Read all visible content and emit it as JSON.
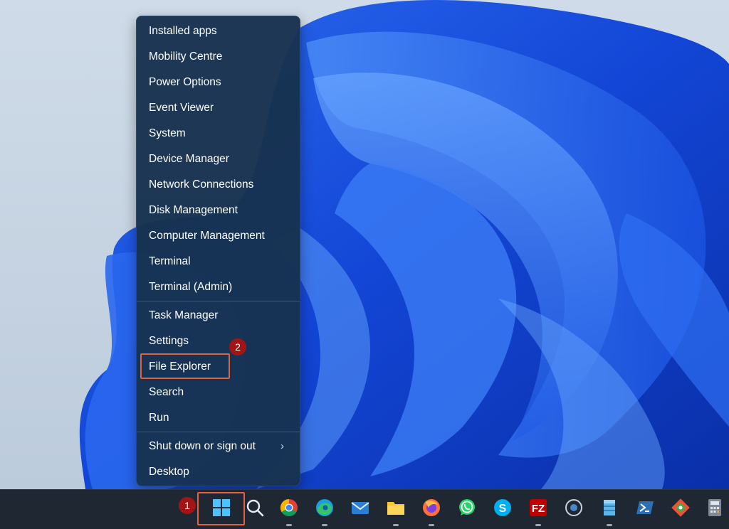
{
  "menu": {
    "items": [
      {
        "label": "Installed apps"
      },
      {
        "label": "Mobility Centre"
      },
      {
        "label": "Power Options"
      },
      {
        "label": "Event Viewer"
      },
      {
        "label": "System"
      },
      {
        "label": "Device Manager"
      },
      {
        "label": "Network Connections"
      },
      {
        "label": "Disk Management"
      },
      {
        "label": "Computer Management"
      },
      {
        "label": "Terminal"
      },
      {
        "label": "Terminal (Admin)"
      },
      {
        "label": "Task Manager"
      },
      {
        "label": "Settings"
      },
      {
        "label": "File Explorer"
      },
      {
        "label": "Search"
      },
      {
        "label": "Run"
      },
      {
        "label": "Shut down or sign out",
        "submenu": true
      },
      {
        "label": "Desktop"
      }
    ],
    "submenu_chevron": "›"
  },
  "annotations": {
    "step1": "1",
    "step2": "2",
    "accent_color": "#e0623f",
    "badge_color": "#a31515"
  },
  "taskbar": {
    "icons": [
      "windows-start-icon",
      "search-icon",
      "chrome-icon",
      "edge-icon",
      "mail-icon",
      "file-explorer-icon",
      "firefox-icon",
      "whatsapp-icon",
      "skype-icon",
      "filezilla-icon",
      "cortana-icon",
      "azure-storage-icon",
      "powershell-icon",
      "git-icon",
      "calculator-icon"
    ]
  }
}
